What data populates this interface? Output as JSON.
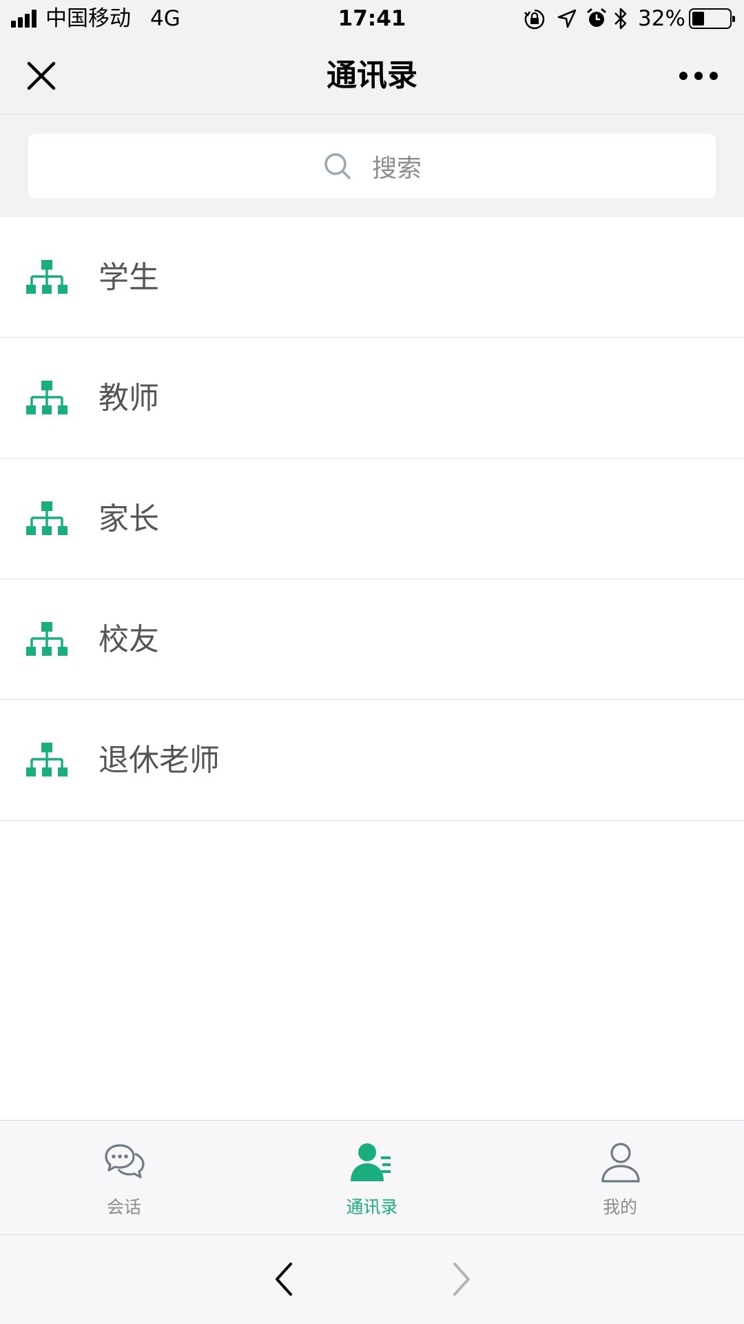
{
  "status_bar": {
    "carrier": "中国移动",
    "network": "4G",
    "time": "17:41",
    "battery_percent": "32%",
    "battery_level": 0.32,
    "icons": [
      "orientation-lock-icon",
      "location-icon",
      "alarm-icon",
      "bluetooth-icon"
    ]
  },
  "nav": {
    "title": "通讯录",
    "close_icon": "close-icon",
    "more_icon": "more-icon"
  },
  "search": {
    "placeholder": "搜索"
  },
  "list": {
    "items": [
      {
        "label": "学生",
        "icon": "org-chart-icon"
      },
      {
        "label": "教师",
        "icon": "org-chart-icon"
      },
      {
        "label": "家长",
        "icon": "org-chart-icon"
      },
      {
        "label": "校友",
        "icon": "org-chart-icon"
      },
      {
        "label": "退休老师",
        "icon": "org-chart-icon"
      }
    ]
  },
  "tabs": [
    {
      "label": "会话",
      "icon": "chat-bubbles-icon",
      "active": false
    },
    {
      "label": "通讯录",
      "icon": "contacts-icon",
      "active": true
    },
    {
      "label": "我的",
      "icon": "profile-icon",
      "active": false
    }
  ],
  "colors": {
    "accent": "#1aad7e",
    "inactive": "#8c8c8c",
    "background_gray": "#f2f2f2"
  }
}
